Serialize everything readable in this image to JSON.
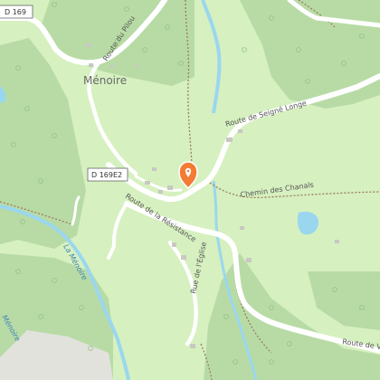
{
  "map": {
    "place_name": "Ménoire",
    "road_shields": {
      "d169": "D 169",
      "d169e2": "D 169E2"
    },
    "road_labels": {
      "route_du_pilou": "Route du Pilou",
      "route_seigne_longe": "Route de Seigné Longe",
      "chemin_des_chanals": "Chemin des Chanals",
      "route_de_la_resistance": "Route de la Résistance",
      "rue_de_leglise": "Rue de l'Église",
      "route_de_v": "Route de V"
    },
    "water_labels": {
      "la_menoire": "La Ménoire",
      "menoire_edge": "Ménoire"
    },
    "marker": {
      "icon": "map-pin-icon",
      "color": "#f47b34"
    },
    "colors": {
      "land": "#d6f0c0",
      "forest": "#b8dba6",
      "water": "#9ad7ef",
      "road": "#ffffff",
      "trail": "#9b7c5b"
    }
  }
}
